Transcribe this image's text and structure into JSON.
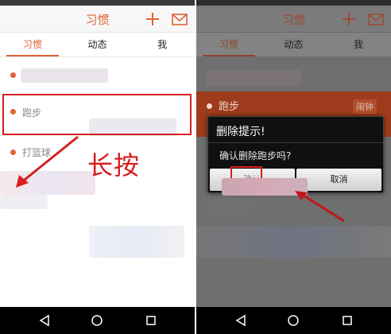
{
  "app": {
    "title": "习惯"
  },
  "tabs": [
    {
      "label": "习惯"
    },
    {
      "label": "动态"
    },
    {
      "label": "我"
    }
  ],
  "left": {
    "rows": [
      {
        "label": "跑步"
      },
      {
        "label": "打篮球"
      }
    ],
    "annotation": "长按"
  },
  "right": {
    "row_label": "跑步",
    "alarm_label": "闹钟",
    "dialog": {
      "title": "删除提示!",
      "message": "确认删除跑步吗?",
      "confirm_label": "确认",
      "cancel_label": "取消"
    }
  },
  "colors": {
    "accent": "#e0633a",
    "annotation": "#d81e1e"
  },
  "icons": [
    "plus-icon",
    "mail-icon",
    "back-icon",
    "home-icon",
    "recent-apps-icon"
  ]
}
